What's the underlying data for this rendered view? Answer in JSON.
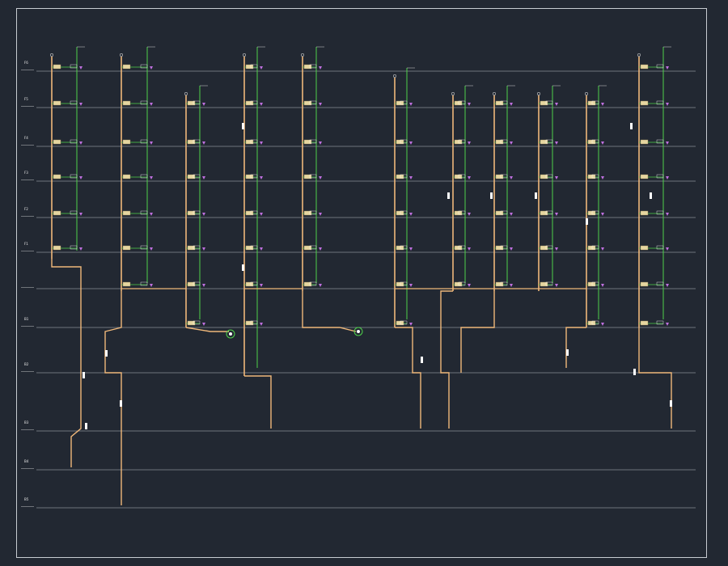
{
  "drawing": {
    "title": "",
    "colors": {
      "background": "#222832",
      "frame": "#c8ccd2",
      "floor_line": "#8a8f96",
      "main_pipe": "#f0b87a",
      "branch_pipe": "#4dd14a",
      "valve": "#e6d6a0",
      "marker": "#c070e0",
      "text": "#ffffff",
      "level_text": "#e8e8e8"
    },
    "floors": [
      {
        "tag": "F6",
        "elev": ""
      },
      {
        "tag": "F5",
        "elev": ""
      },
      {
        "tag": "F4",
        "elev": ""
      },
      {
        "tag": "F3",
        "elev": ""
      },
      {
        "tag": "F2",
        "elev": ""
      },
      {
        "tag": "F1",
        "elev": ""
      },
      {
        "tag": "",
        "elev": ""
      },
      {
        "tag": "B1",
        "elev": ""
      },
      {
        "tag": "B2",
        "elev": ""
      },
      {
        "tag": "B3",
        "elev": ""
      },
      {
        "tag": "B4",
        "elev": ""
      },
      {
        "tag": "B5",
        "elev": ""
      }
    ]
  }
}
